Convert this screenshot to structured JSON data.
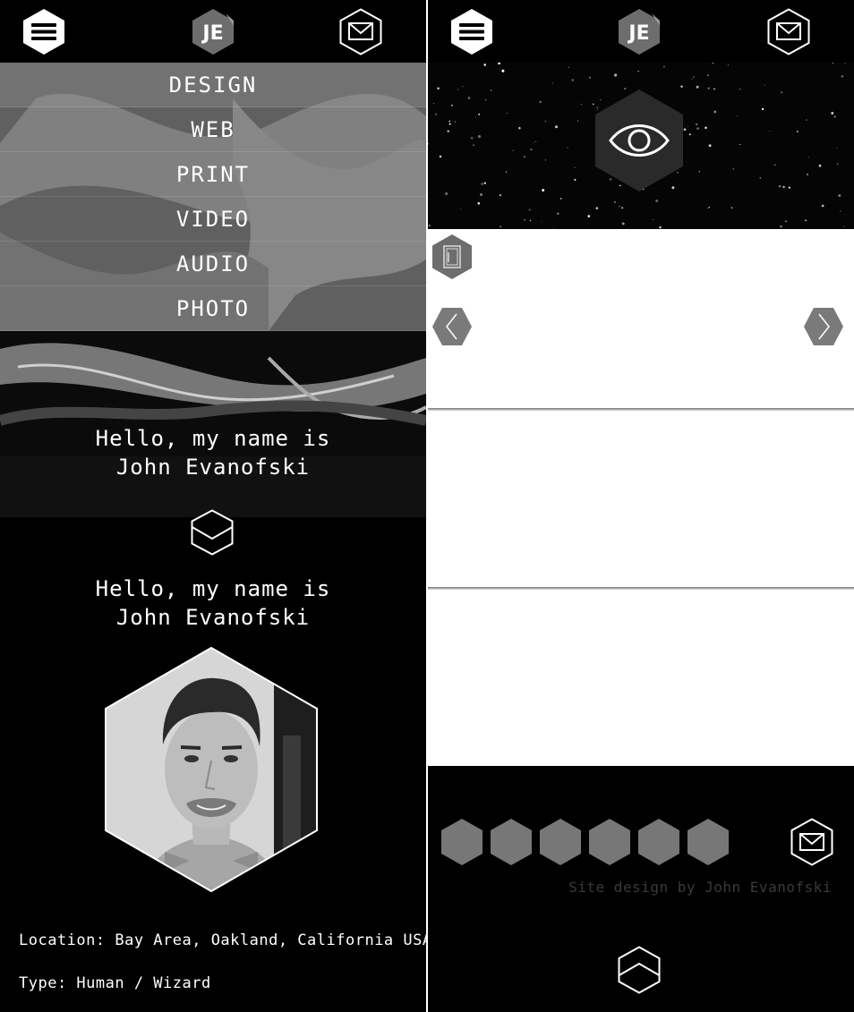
{
  "left": {
    "topbar": {
      "menu_icon": "hamburger-icon",
      "logo_text": "JE",
      "mail_icon": "envelope-icon"
    },
    "menu": {
      "items": [
        "DESIGN",
        "WEB",
        "PRINT",
        "VIDEO",
        "AUDIO",
        "PHOTO"
      ]
    },
    "hero": {
      "greeting_line1": "Hello, my name is",
      "greeting_line2": "John Evanofski"
    },
    "scroll_icon": "chevron-down-icon",
    "about": {
      "greeting_line1": "Hello, my name is",
      "greeting_line2": "John Evanofski",
      "location": "Location: Bay Area, Oakland, California USA",
      "type": "Type: Human / Wizard"
    }
  },
  "right": {
    "topbar": {
      "menu_icon": "hamburger-icon",
      "logo_text": "JE",
      "mail_icon": "envelope-icon"
    },
    "banner_icon": "eye-icon",
    "gallery": {
      "icon": "document-icon",
      "prev_icon": "chevron-left-icon",
      "next_icon": "chevron-right-icon"
    },
    "footer": {
      "social_icon_count": 6,
      "mail_icon": "envelope-icon",
      "credit": "Site design by John Evanofski",
      "top_icon": "chevron-up-icon"
    }
  },
  "colors": {
    "background": "#000000",
    "text": "#ffffff",
    "hex_gray": "#777777",
    "credit_text": "#3a3a3a"
  }
}
